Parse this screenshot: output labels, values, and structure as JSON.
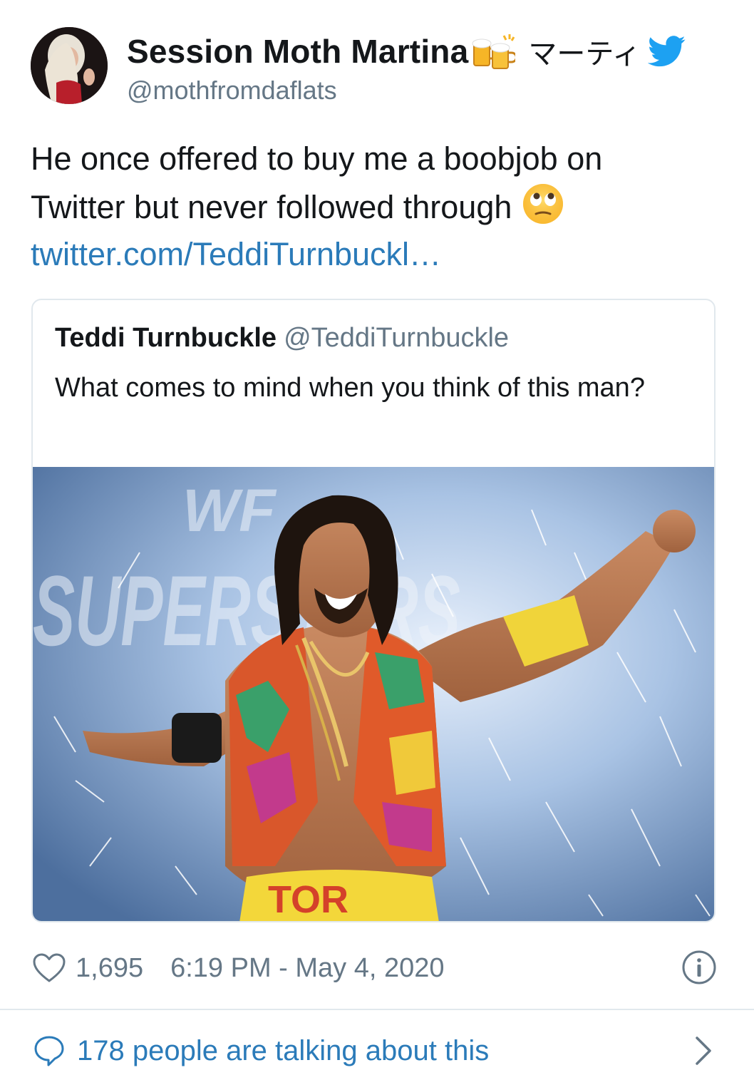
{
  "author": {
    "display_name": "Session Moth Martina",
    "display_name_suffix": "マーティ",
    "handle": "@mothfromdaflats",
    "name_emoji_icon": "beer-mugs-icon",
    "verified_icon": "twitter-bird-icon"
  },
  "tweet": {
    "text_line_1": "He once offered to buy me a boobjob on",
    "text_line_2": "Twitter but never followed through",
    "emoji_icon": "eye-roll-emoji-icon",
    "link": "twitter.com/TeddiTurnbuckl…"
  },
  "quoted_tweet": {
    "name": "Teddi Turnbuckle",
    "handle": "@TeddiTurnbuckle",
    "text": "What comes to mind when you think of this man?",
    "image_sign_text": "SUPERSTARS",
    "image_logo_text": "WF",
    "image_trunks_text": "TOR"
  },
  "meta": {
    "likes": "1,695",
    "timestamp": "6:19 PM - May 4, 2020",
    "like_icon": "heart-icon",
    "info_icon": "info-icon"
  },
  "footer": {
    "talking_text": "178 people are talking about this",
    "bubble_icon": "speech-bubble-icon",
    "chevron_icon": "chevron-right-icon"
  },
  "colors": {
    "link_blue": "#2b7bb9",
    "secondary_gray": "#657786",
    "border": "#e1e8ed",
    "twitter_blue": "#1da1f2"
  }
}
